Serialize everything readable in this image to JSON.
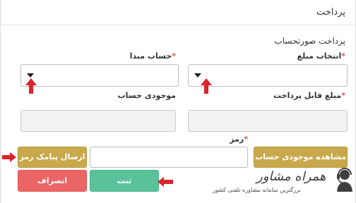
{
  "panel": {
    "title": "پرداخت"
  },
  "section": {
    "title": "پرداخت صورتحساب"
  },
  "fields": {
    "amount_select_label": "انتخاب مبلغ",
    "source_account_label": "حساب مبدا",
    "payable_amount_label": "مبلغ قابل پرداخت",
    "account_balance_label": "موجودی حساب",
    "password_label": "رمز",
    "required_mark": "*"
  },
  "buttons": {
    "view_balance": "مشاهده موجودی حساب",
    "send_sms_password": "ارسال پیامک رمز",
    "submit": "ثبت",
    "cancel": "انصراف"
  },
  "watermark": {
    "brand": "همراه مشاور",
    "tagline": "بزرگترین سامانه مشاوره تلفنی کشور"
  },
  "colors": {
    "gold_button": "#c9a84c",
    "green_button": "#59c29a",
    "red_button": "#ec6565",
    "annotation_arrow": "#d9252b",
    "required_mark": "#d9534f"
  },
  "icons": {
    "dropdown": "caret-down-icon",
    "annotation": "arrow-icon",
    "brand": "headset-icon"
  }
}
